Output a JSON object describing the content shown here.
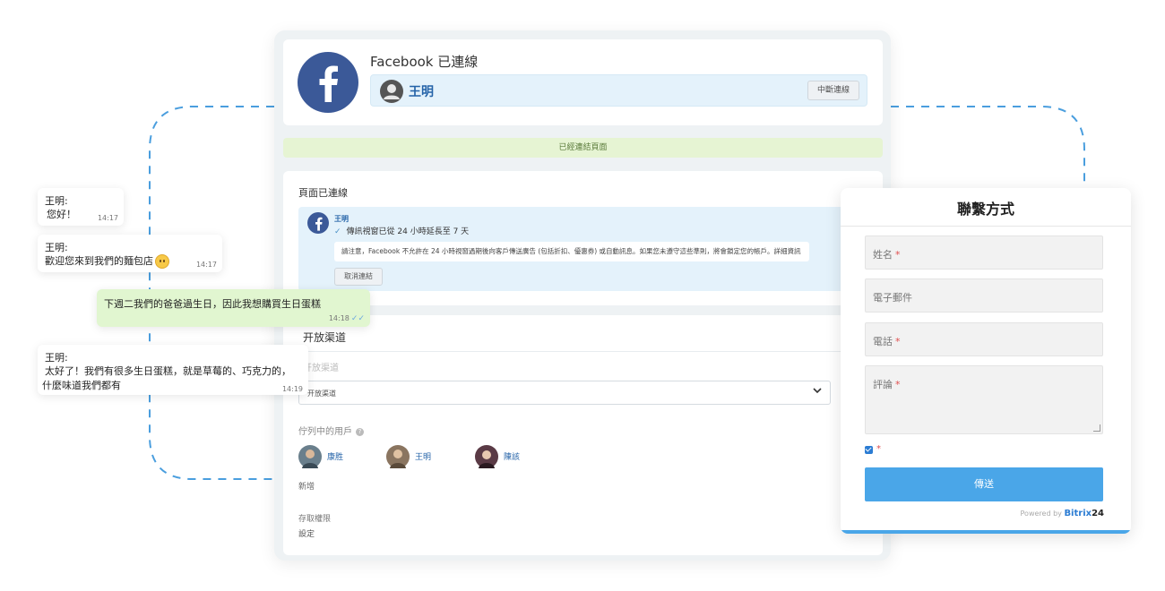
{
  "facebook": {
    "title": "Facebook 已連線",
    "user_name": "王明",
    "disconnect_label": "中斷連線"
  },
  "banner": {
    "text": "已經連結頁面"
  },
  "page": {
    "heading": "頁面已連線",
    "info_user": "王明",
    "info_line": "傳訊視窗已從 24 小時延長至 7 天",
    "notice": "請注意，Facebook 不允許在 24 小時視窗過期後向客戶傳送廣告 (包括折扣、優惠券) 或自動訊息。如果您未遵守這些準則，將會鎖定您的帳戶。詳細資訊",
    "cancel_label": "取消連結"
  },
  "open_channel": {
    "title": "开放渠道",
    "hint": "开放渠道",
    "select_value": "开放渠道",
    "queue_label": "佇列中的用戶",
    "users": [
      {
        "name": "康胜",
        "color": "#6a7f8c"
      },
      {
        "name": "王明",
        "color": "#8a7560"
      },
      {
        "name": "陳該",
        "color": "#5a3a45"
      }
    ],
    "add_label": "新增",
    "access_label": "存取權限",
    "settings_label": "設定"
  },
  "chat": [
    {
      "sender": "王明:",
      "text": "您好！",
      "time": "14:17",
      "outgoing": false
    },
    {
      "sender": "王明:",
      "text": "歡迎您來到我們的麵包店",
      "time": "14:17",
      "outgoing": false
    },
    {
      "sender": "",
      "text": "下週二我們的爸爸過生日，因此我想購買生日蛋糕",
      "time": "14:18",
      "outgoing": true
    },
    {
      "sender": "王明:",
      "text": "太好了！我們有很多生日蛋糕，就是草莓的、巧克力的，",
      "text2": "什麼味道我們都有",
      "time": "14:19",
      "outgoing": false
    }
  ],
  "form": {
    "title": "聯繫方式",
    "name_label": "姓名",
    "email_label": "電子郵件",
    "phone_label": "電話",
    "comment_label": "評論",
    "required_mark": "*",
    "send_label": "傳送",
    "powered_by": "Powered by",
    "brand": "Bitrix",
    "brand_num": "24"
  },
  "colors": {
    "facebook_blue": "#3b5998",
    "accent_blue": "#4aa6e8",
    "banner_green": "#e6f4d3",
    "outgoing_bubble": "#e1f6d0"
  }
}
